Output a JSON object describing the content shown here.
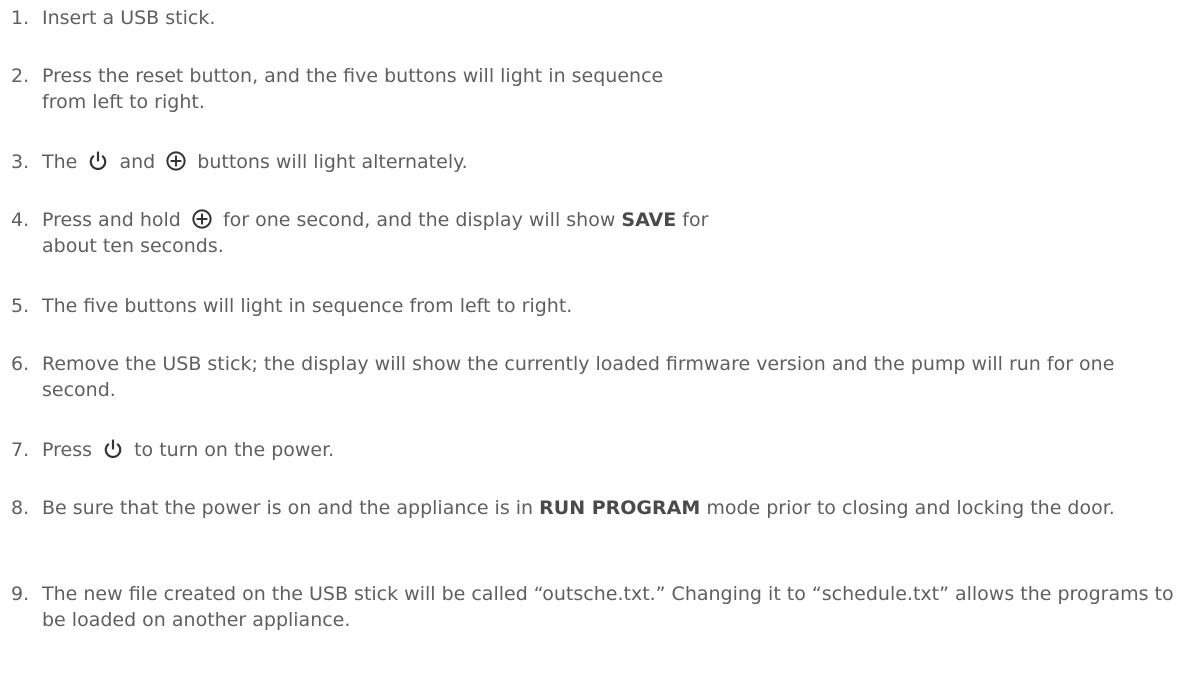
{
  "steps": [
    {
      "number": "1.",
      "text": "Insert a USB stick."
    },
    {
      "number": "2.",
      "line1": "Press the reset button, and the five buttons will light in sequence",
      "line2": "from left to right."
    },
    {
      "number": "3.",
      "pre": "The",
      "mid": "and",
      "post": "buttons will light alternately."
    },
    {
      "number": "4.",
      "pre": "Press and hold",
      "post": "for one second, and the display will show",
      "bold": "SAVE",
      "post2": "for",
      "line2": "about ten seconds."
    },
    {
      "number": "5.",
      "text": "The five buttons will light in sequence from left to right."
    },
    {
      "number": "6.",
      "text": "Remove the USB stick; the display will show the currently loaded firmware version and the pump will run for one second."
    },
    {
      "number": "7.",
      "pre": "Press",
      "post": "to turn on the power."
    },
    {
      "number": "8.",
      "pre": "Be sure that the power is on and the appliance is in",
      "bold": "RUN PROGRAM",
      "post": "mode prior to closing and locking the door."
    },
    {
      "number": "9.",
      "text": "The new file created on the USB stick will be called “outsche.txt.” Changing it to “schedule.txt” allows the programs to be loaded on another appliance."
    }
  ],
  "icons": {
    "power": "power-icon",
    "plus": "circle-plus-icon"
  }
}
